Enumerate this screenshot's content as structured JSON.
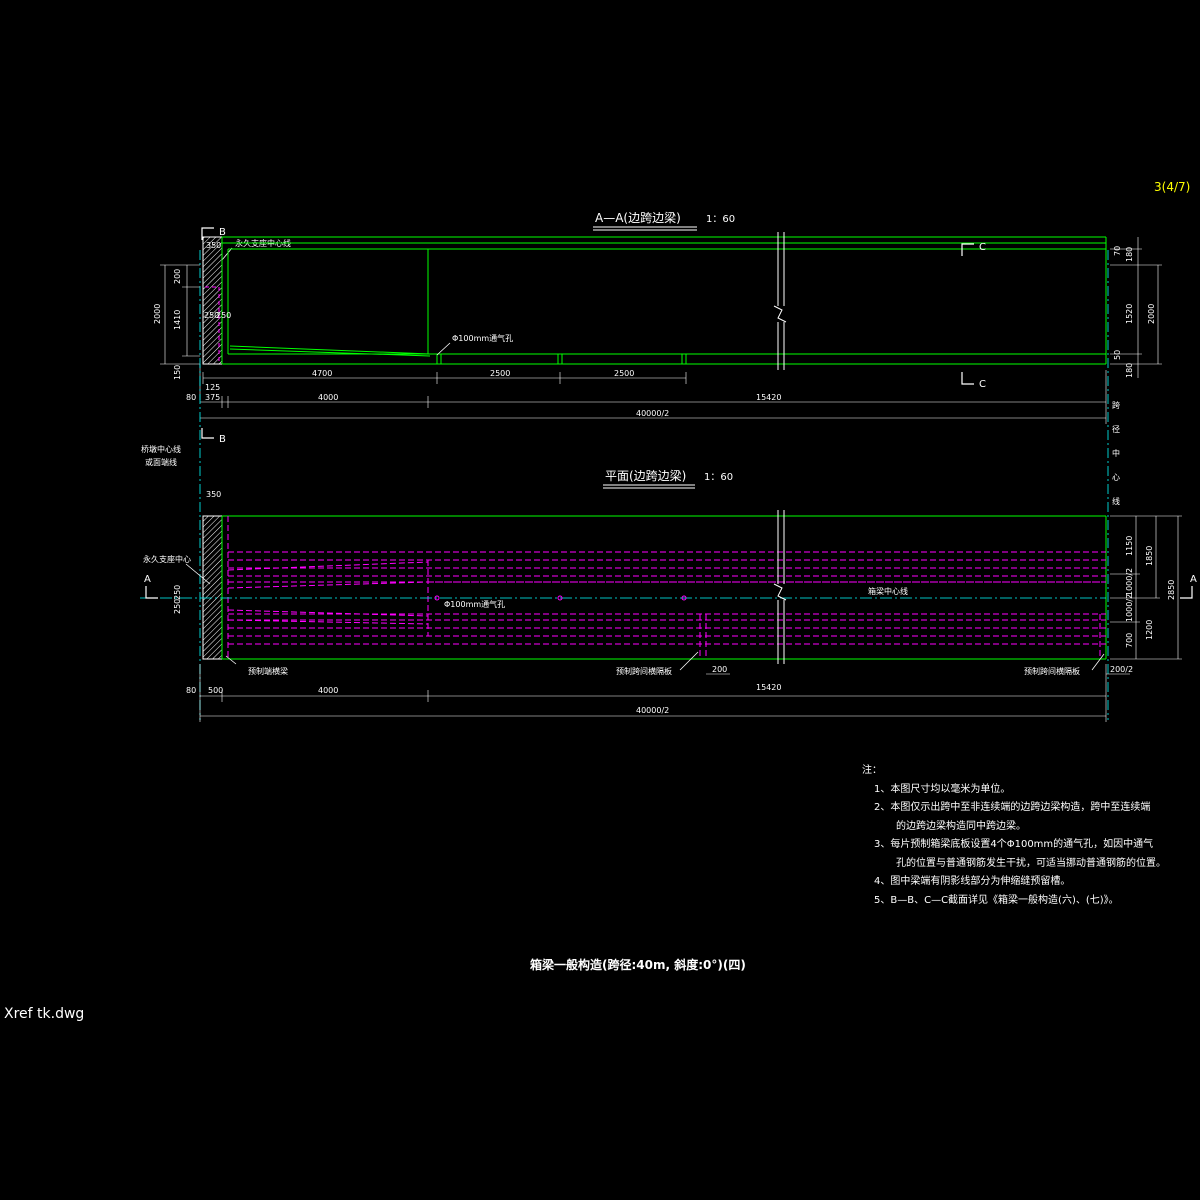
{
  "sheet": {
    "page_number": "3(4/7)",
    "xref_label": "Xref tk.dwg",
    "drawing_title": "箱梁一般构造(跨径:40m, 斜度:0°)(四)"
  },
  "section_view": {
    "title": "A—A(边跨边梁)",
    "scale": "1：60",
    "labels": {
      "support_center": "永久支座中心线",
      "vent_hole": "Φ100mm通气孔",
      "section_b": "B",
      "section_c": "C"
    },
    "dims_top": [
      "350"
    ],
    "dims_left": [
      "2000",
      "1410",
      "200",
      "150",
      "250"
    ],
    "dims_left_small": [
      "250"
    ],
    "dims_bottom_row1": [
      "125",
      "4700",
      "2500",
      "2500"
    ],
    "dims_bottom_row2": [
      "80",
      "375",
      "4000",
      "15420"
    ],
    "dims_bottom_row3": [
      "40000/2"
    ],
    "dims_right": [
      "180",
      "70",
      "1520",
      "2000",
      "50",
      "180"
    ]
  },
  "plan_view": {
    "title": "平面(边跨边梁)",
    "scale": "1：60",
    "labels": {
      "abutment_center": "桥墩中心线",
      "end_line": "或面端线",
      "support_center": "永久支座中心",
      "vent_hole": "Φ100mm通气孔",
      "beam_center": "箱梁中心线",
      "end_diaphragm": "预制端横梁",
      "mid_diaphragm": "预制跨间横隔板",
      "mid_diaphragm_right": "预制跨间横隔板",
      "span_center": "跨径中心线",
      "section_a": "A",
      "section_b": "B"
    },
    "dims_top": [
      "350"
    ],
    "dims_left": [
      "250",
      "250"
    ],
    "dims_right": [
      "1150",
      "1850",
      "1000/2",
      "1000/2",
      "1200",
      "700",
      "2850"
    ],
    "dims_bottom_row1": [
      "200",
      "200/2"
    ],
    "dims_bottom_row2": [
      "80",
      "500",
      "4000",
      "15420"
    ],
    "dims_bottom_row3": [
      "40000/2"
    ]
  },
  "notes": {
    "heading": "注：",
    "items": [
      "1、本图尺寸均以毫米为单位。",
      "2、本图仅示出跨中至非连续端的边跨边梁构造，跨中至连续端",
      "的边跨边梁构造同中跨边梁。",
      "3、每片预制箱梁底板设置4个Φ100mm的通气孔，如因中通气",
      "孔的位置与普通钢筋发生干扰，可适当挪动普通钢筋的位置。",
      "4、图中梁端有阴影线部分为伸缩缝预留槽。",
      "5、B—B、C—C截面详见《箱梁一般构造(六)、(七)》。"
    ]
  },
  "colors": {
    "green": "#00ff00",
    "magenta": "#ff00ff",
    "cyan": "#00ffff",
    "white": "#ffffff",
    "yellow": "#ffff00"
  }
}
